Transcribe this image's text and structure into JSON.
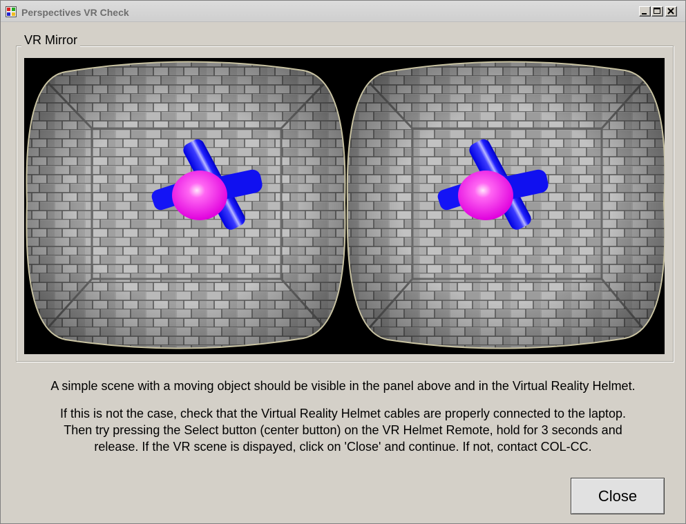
{
  "window": {
    "title": "Perspectives VR Check",
    "controls": {
      "minimize": "minimize-icon",
      "maximize": "maximize-icon",
      "close": "close-icon"
    }
  },
  "group": {
    "legend": "VR Mirror",
    "viewports": [
      "left-eye",
      "right-eye"
    ]
  },
  "message": {
    "line1": "A simple scene with a moving object should be visible in the panel above and in the Virtual Reality Helmet.",
    "line2a": "If this is not the case, check that the Virtual Reality Helmet cables are properly connected to the laptop.",
    "line2b": "Then try pressing the Select button (center button) on the VR Helmet Remote, hold for 3 seconds and",
    "line2c": "release. If the VR scene is dispayed, click on 'Close' and continue. If not, contact COL-CC."
  },
  "buttons": {
    "close_label": "Close"
  },
  "colors": {
    "dialog_bg": "#d4d0c8",
    "object_sphere": "#ff22ee",
    "object_cylinders": "#1010ff",
    "wall": "#9a9a9a"
  }
}
